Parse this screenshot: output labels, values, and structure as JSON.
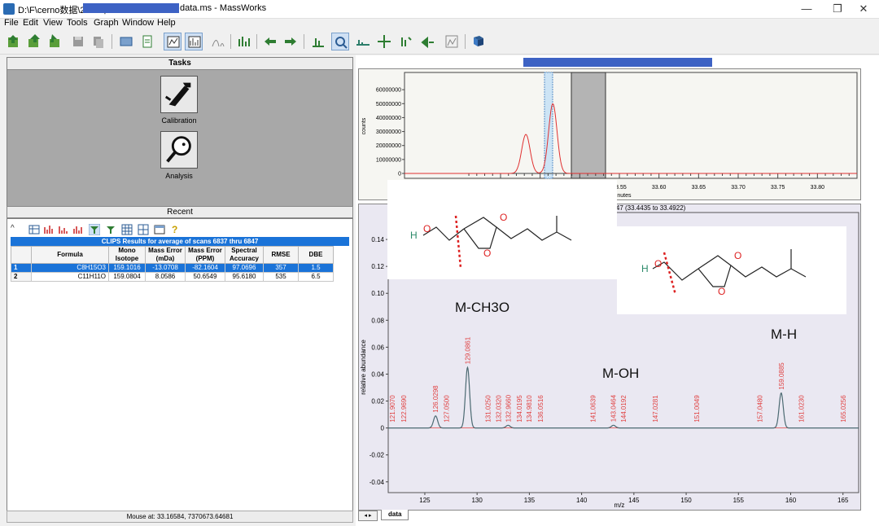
{
  "window": {
    "title_prefix": "D:\\F\\cerno数据\\2026年",
    "title_suffix": "data.ms - MassWorks",
    "minimize": "—",
    "maximize": "❐",
    "close": "✕"
  },
  "menu": [
    "File",
    "Edit",
    "View",
    "Tools",
    "Graph",
    "Window",
    "Help"
  ],
  "tasks": {
    "header": "Tasks",
    "items": [
      {
        "label": "Calibration"
      },
      {
        "label": "Analysis"
      }
    ],
    "recent": "Recent"
  },
  "results": {
    "title": "CLIPS Results for average of scans 6837 thru 6847",
    "columns": [
      "",
      "Formula",
      "Mono Isotope",
      "Mass Error (mDa)",
      "Mass Error (PPM)",
      "Spectral Accuracy",
      "RMSE",
      "DBE"
    ],
    "rows": [
      [
        "1",
        "C8H15O3",
        "159.1016",
        "-13.0708",
        "-82.1604",
        "97.0696",
        "357",
        "1.5"
      ],
      [
        "2",
        "C11H11O",
        "159.0804",
        "8.0586",
        "50.6549",
        "95.6180",
        "535",
        "6.5"
      ]
    ]
  },
  "status": {
    "mouse": "Mouse at: 33.16584, 7370673.64681"
  },
  "chromatogram": {
    "ylabel": "counts",
    "xlabel": "minutes",
    "yticks": [
      "0",
      "10000000",
      "20000000",
      "30000000",
      "40000000",
      "50000000",
      "60000000"
    ],
    "xticks": [
      "33.55",
      "33.60",
      "33.65",
      "33.70",
      "33.75",
      "33.80"
    ],
    "caption": "6847 (33.4435 to 33.4922)"
  },
  "spectrum_tab": "data",
  "annotations": {
    "m_ch3o": "M-CH3O",
    "m_oh": "M-OH",
    "m_h": "M-H"
  },
  "molecule_labels": {
    "h": "H",
    "o": "O"
  },
  "chart_data": [
    {
      "type": "line",
      "name": "mass-spectrum",
      "xlabel": "m/z",
      "ylabel": "relative abundance",
      "xlim": [
        121.5,
        166.5
      ],
      "ylim": [
        -0.048,
        0.16
      ],
      "xticks": [
        125,
        130,
        135,
        140,
        145,
        150,
        155,
        160,
        165
      ],
      "yticks": [
        -0.04,
        -0.02,
        0,
        0.02,
        0.04,
        0.06,
        0.08,
        0.1,
        0.12,
        0.14
      ],
      "peaks": [
        {
          "mz": 126.0298,
          "y": 0.009,
          "label": "126.0298"
        },
        {
          "mz": 129.0861,
          "y": 0.045,
          "label": "129.0861"
        },
        {
          "mz": 132.966,
          "y": 0.002,
          "label": "132.9660"
        },
        {
          "mz": 143.0464,
          "y": 0.002,
          "label": "143.0464"
        },
        {
          "mz": 159.0885,
          "y": 0.026,
          "label": "159.0885"
        }
      ],
      "minor_labels": [
        "122.9690",
        "127.0500",
        "131.0250",
        "132.0320",
        "134.0195",
        "134.9810",
        "136.0516",
        "141.0639",
        "144.0192",
        "147.0281",
        "151.0049",
        "157.0480",
        "161.0230",
        "165.0256"
      ],
      "minor_mz": [
        122.969,
        127.05,
        131.025,
        132.032,
        134.0195,
        134.981,
        136.0516,
        141.0639,
        144.0192,
        147.0281,
        151.0049,
        157.048,
        161.023,
        165.0256
      ],
      "partial_label": "121.9070",
      "partial_mz": 121.907
    },
    {
      "type": "line",
      "name": "chromatogram",
      "xlabel": "minutes",
      "ylabel": "counts",
      "peaks": [
        {
          "x": 33.432,
          "y": 28000000
        },
        {
          "x": 33.466,
          "y": 50000000
        }
      ]
    }
  ]
}
